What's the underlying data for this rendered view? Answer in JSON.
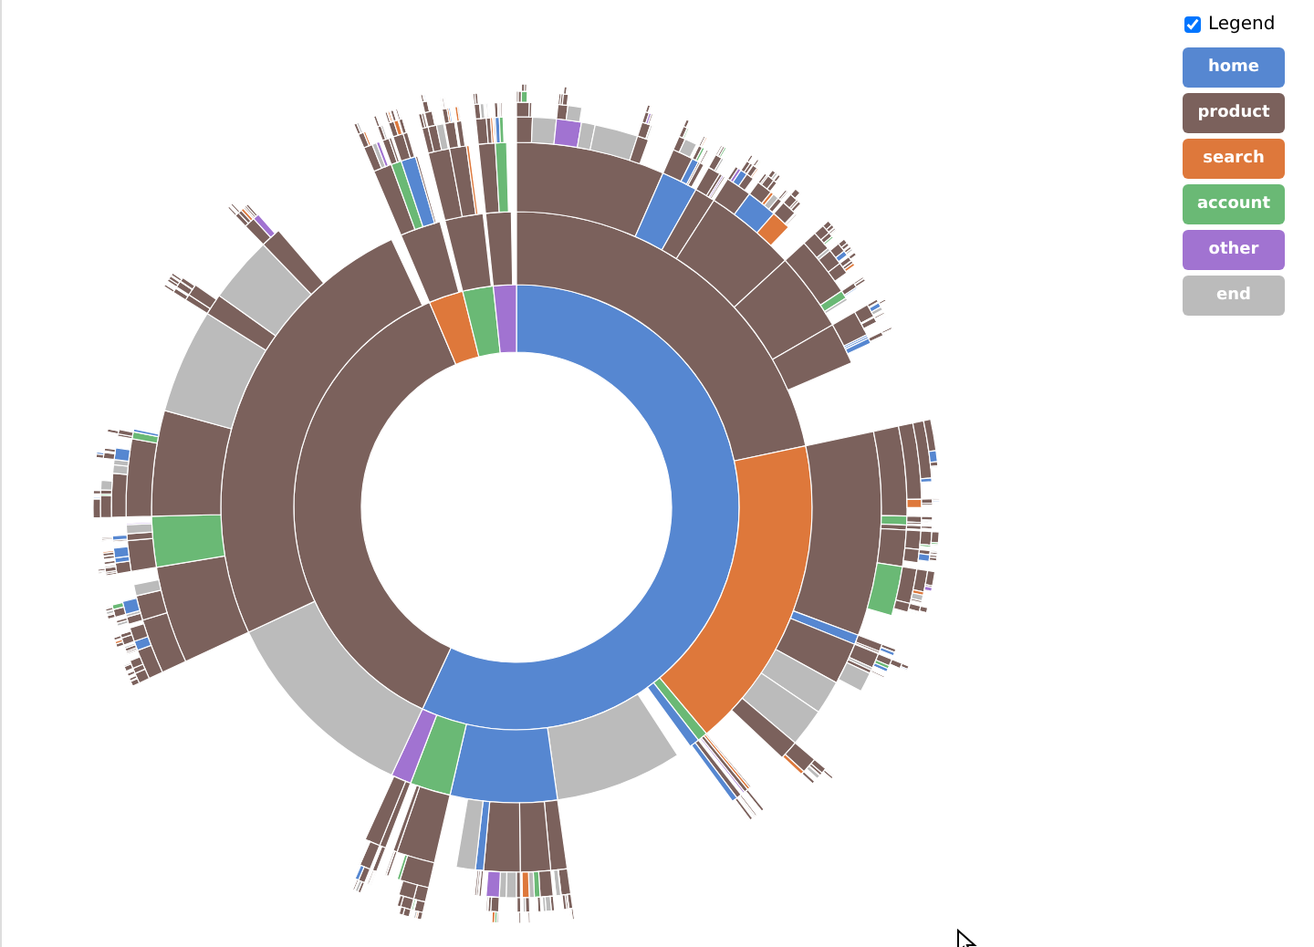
{
  "legend_toggle": {
    "label": "Legend",
    "checked": true
  },
  "legend": [
    {
      "label": "home",
      "color": "#5687d1"
    },
    {
      "label": "product",
      "color": "#7b615c"
    },
    {
      "label": "search",
      "color": "#de783b"
    },
    {
      "label": "account",
      "color": "#6ab975"
    },
    {
      "label": "other",
      "color": "#a173d1"
    },
    {
      "label": "end",
      "color": "#bbbbbb"
    }
  ]
}
